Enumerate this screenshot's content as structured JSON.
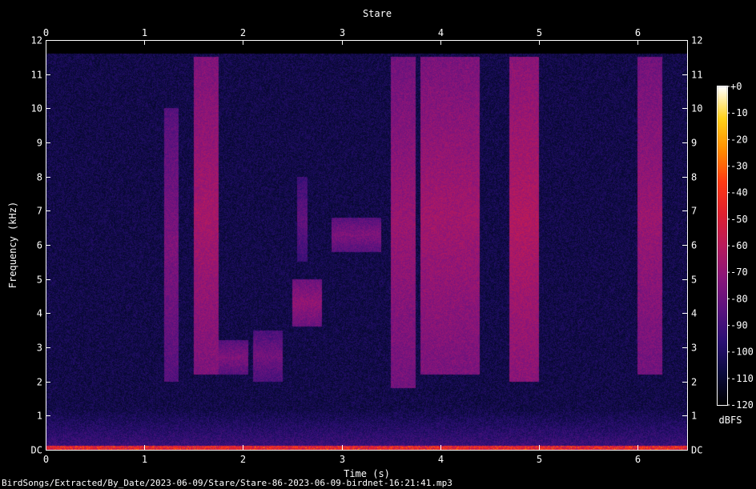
{
  "chart_data": {
    "type": "heatmap",
    "title": "Stare",
    "xlabel": "Time (s)",
    "ylabel": "Frequency (kHz)",
    "x_range": [
      0,
      6.5
    ],
    "y_range": [
      0,
      12
    ],
    "x_ticks": [
      "0",
      "1",
      "2",
      "3",
      "4",
      "5",
      "6"
    ],
    "y_ticks": [
      "DC",
      "1",
      "2",
      "3",
      "4",
      "5",
      "6",
      "7",
      "8",
      "9",
      "10",
      "11",
      "12"
    ],
    "colorbar": {
      "label": "dBFS",
      "range": [
        -120,
        0
      ],
      "ticks": [
        "+0",
        "-10",
        "-20",
        "-30",
        "-40",
        "-50",
        "-60",
        "-70",
        "-80",
        "-90",
        "-100",
        "-110",
        "-120"
      ],
      "colors": [
        "#000000",
        "#0a0a3c",
        "#2a0f73",
        "#5a127e",
        "#8a157a",
        "#b81a5c",
        "#e01f30",
        "#ff3a14",
        "#ff8c00",
        "#ffd21a",
        "#ffffff"
      ]
    },
    "background_level_db": -105,
    "signal_ceiling_khz": 11.6,
    "events": [
      {
        "t_start": 1.2,
        "t_end": 1.35,
        "f_low": 2.0,
        "f_high": 10.0,
        "peak_db": -75
      },
      {
        "t_start": 1.5,
        "t_end": 1.75,
        "f_low": 2.2,
        "f_high": 11.5,
        "peak_db": -65
      },
      {
        "t_start": 1.75,
        "t_end": 2.05,
        "f_low": 2.2,
        "f_high": 3.2,
        "peak_db": -75
      },
      {
        "t_start": 2.1,
        "t_end": 2.4,
        "f_low": 2.0,
        "f_high": 3.5,
        "peak_db": -78
      },
      {
        "t_start": 2.5,
        "t_end": 2.8,
        "f_low": 3.6,
        "f_high": 5.0,
        "peak_db": -70
      },
      {
        "t_start": 2.55,
        "t_end": 2.65,
        "f_low": 5.5,
        "f_high": 8.0,
        "peak_db": -82
      },
      {
        "t_start": 2.9,
        "t_end": 3.4,
        "f_low": 5.8,
        "f_high": 6.8,
        "peak_db": -75
      },
      {
        "t_start": 3.5,
        "t_end": 3.75,
        "f_low": 1.8,
        "f_high": 11.5,
        "peak_db": -68
      },
      {
        "t_start": 3.8,
        "t_end": 4.4,
        "f_low": 2.2,
        "f_high": 11.5,
        "peak_db": -66
      },
      {
        "t_start": 4.7,
        "t_end": 5.0,
        "f_low": 2.0,
        "f_high": 11.5,
        "peak_db": -62
      },
      {
        "t_start": 6.0,
        "t_end": 6.25,
        "f_low": 2.2,
        "f_high": 11.5,
        "peak_db": -68
      }
    ]
  },
  "footer": {
    "path": "BirdSongs/Extracted/By_Date/2023-06-09/Stare/Stare-86-2023-06-09-birdnet-16:21:41.mp3"
  }
}
